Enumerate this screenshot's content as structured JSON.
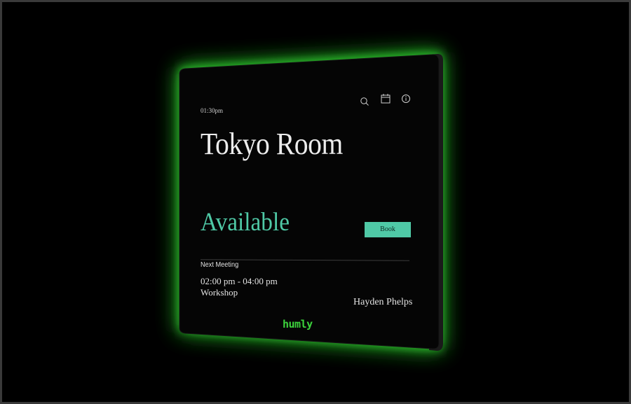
{
  "device": {
    "glow_color": "#2fd02f",
    "bezel_color": "#0b0b0b",
    "accent_color": "#4fc9a6",
    "brand_color": "#3cd23c"
  },
  "header": {
    "time": "01:30pm",
    "icons": [
      "search-icon",
      "calendar-icon",
      "info-icon"
    ]
  },
  "room": {
    "name": "Tokyo Room"
  },
  "status": {
    "label": "Available",
    "book_label": "Book"
  },
  "next_meeting": {
    "heading": "Next Meeting",
    "time": "02:00 pm - 04:00 pm",
    "title": "Workshop",
    "organizer": "Hayden Phelps"
  },
  "brand": {
    "logo_text": "humly"
  }
}
